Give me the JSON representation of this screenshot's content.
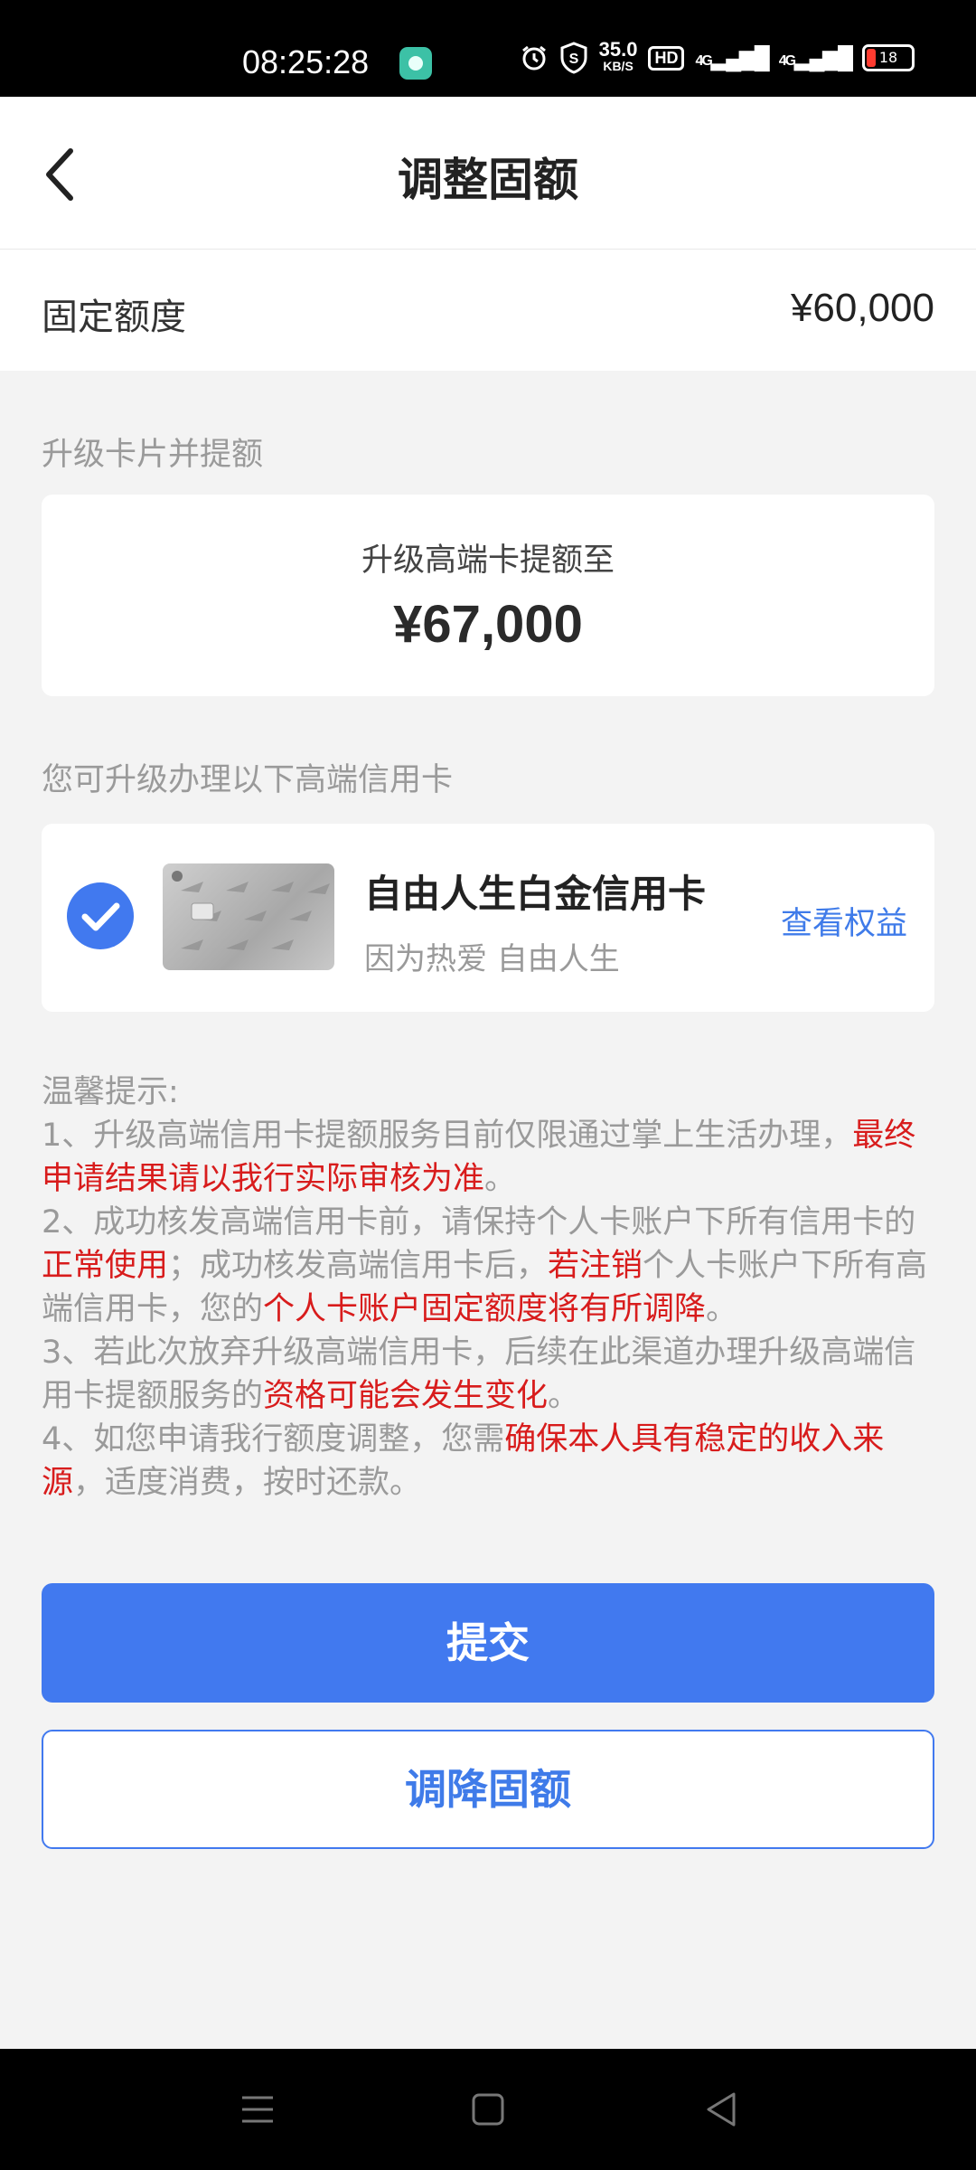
{
  "status_bar": {
    "time": "08:25:28",
    "speed_value": "35.0",
    "speed_unit": "KB/S",
    "hd_label": "HD",
    "signal_1": "4G",
    "signal_2": "4G",
    "battery": "18",
    "icons": [
      "alarm-icon",
      "shield-s-icon",
      "hd-icon",
      "signal-icon",
      "battery-icon"
    ]
  },
  "nav": {
    "title": "调整固额",
    "back_icon": "chevron-left-icon"
  },
  "fixed_quota": {
    "label": "固定额度",
    "value": "¥60,000"
  },
  "upgrade": {
    "section_label": "升级卡片并提额",
    "subtitle": "升级高端卡提额至",
    "amount": "¥67,000"
  },
  "cards": {
    "section_label": "您可升级办理以下高端信用卡",
    "item": {
      "name": "自由人生白金信用卡",
      "slogan": "因为热爱 自由人生",
      "link": "查看权益",
      "selected": true
    }
  },
  "tips": {
    "title": "温馨提示:",
    "t1_a": "1、升级高端信用卡提额服务目前仅限通过掌上生活办理，",
    "t1_b": "最终申请结果请以我行实际审核为准",
    "t1_c": "。",
    "t2_a": "2、成功核发高端信用卡前，请保持个人卡账户下所有信用卡的",
    "t2_b": "正常使用",
    "t2_c": "；成功核发高端信用卡后，",
    "t2_d": "若注销",
    "t2_e": "个人卡账户下所有高端信用卡，您的",
    "t2_f": "个人卡账户固定额度将有所调降",
    "t2_g": "。",
    "t3_a": "3、若此次放弃升级高端信用卡，后续在此渠道办理升级高端信用卡提额服务的",
    "t3_b": "资格可能会发生变化",
    "t3_c": "。",
    "t4_a": "4、如您申请我行额度调整，您需",
    "t4_b": "确保本人具有稳定的收入来源",
    "t4_c": "，适度消费，按时还款。"
  },
  "buttons": {
    "submit": "提交",
    "lower": "调降固额"
  },
  "colors": {
    "primary": "#4179ef",
    "warning_red": "#d81c1c",
    "muted_text": "#9a9a9a"
  }
}
